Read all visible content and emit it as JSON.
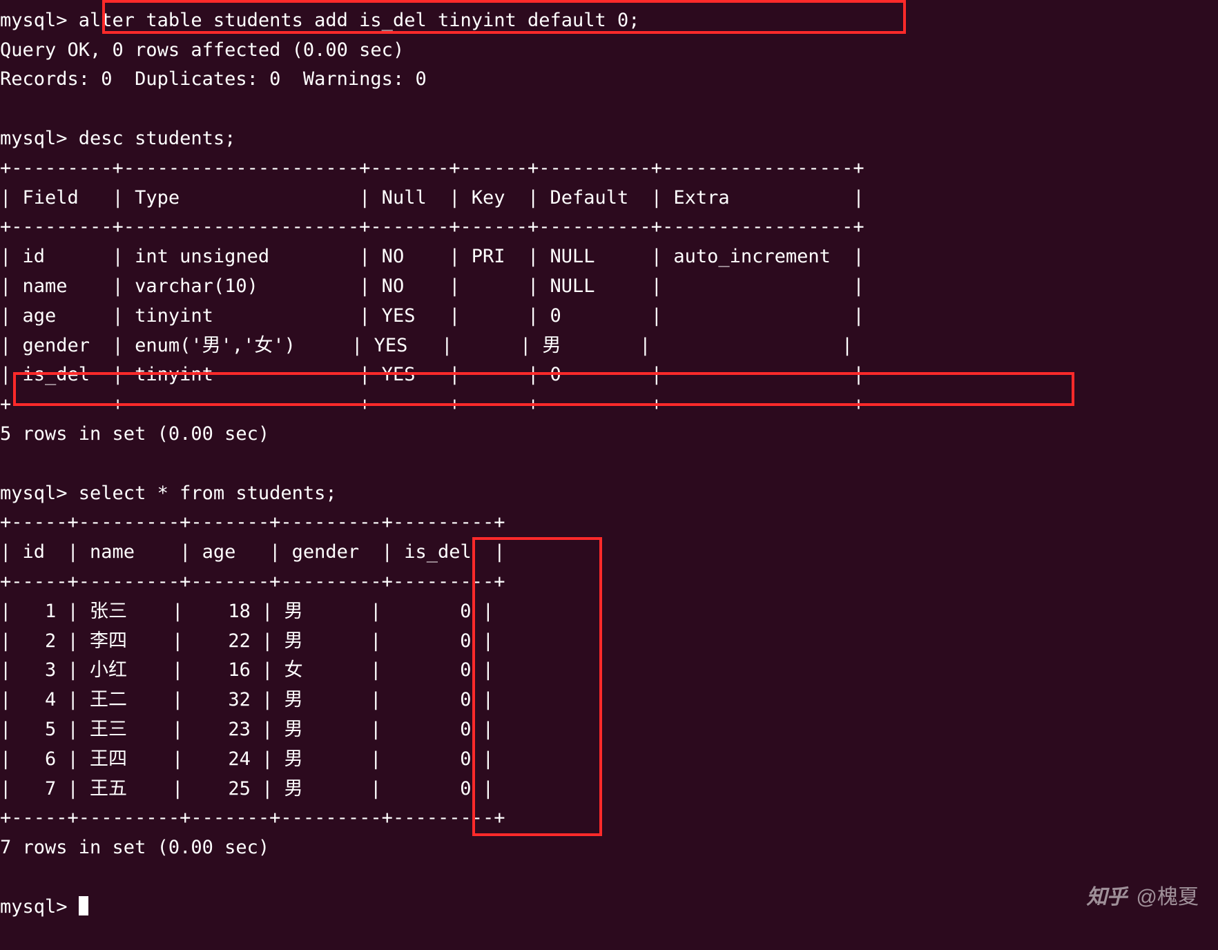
{
  "colors": {
    "bg": "#2c0a1e",
    "fg": "#ffffff",
    "highlight": "#ff2a2a"
  },
  "prompt": "mysql>",
  "alter_cmd": "alter table students add is_del tinyint default 0;",
  "alter_result_line1": "Query OK, 0 rows affected (0.00 sec)",
  "alter_result_line2": "Records: 0  Duplicates: 0  Warnings: 0",
  "desc_cmd": "desc students;",
  "desc_headers": [
    "Field",
    "Type",
    "Null",
    "Key",
    "Default",
    "Extra"
  ],
  "desc_rows": [
    {
      "Field": "id",
      "Type": "int unsigned",
      "Null": "NO",
      "Key": "PRI",
      "Default": "NULL",
      "Extra": "auto_increment"
    },
    {
      "Field": "name",
      "Type": "varchar(10)",
      "Null": "NO",
      "Key": "",
      "Default": "NULL",
      "Extra": ""
    },
    {
      "Field": "age",
      "Type": "tinyint",
      "Null": "YES",
      "Key": "",
      "Default": "0",
      "Extra": ""
    },
    {
      "Field": "gender",
      "Type": "enum('男','女')",
      "Null": "YES",
      "Key": "",
      "Default": "男",
      "Extra": ""
    },
    {
      "Field": "is_del",
      "Type": "tinyint",
      "Null": "YES",
      "Key": "",
      "Default": "0",
      "Extra": ""
    }
  ],
  "desc_footer": "5 rows in set (0.00 sec)",
  "select_cmd": "select * from students;",
  "select_headers": [
    "id",
    "name",
    "age",
    "gender",
    "is_del"
  ],
  "select_rows": [
    {
      "id": "1",
      "name": "张三",
      "age": "18",
      "gender": "男",
      "is_del": "0"
    },
    {
      "id": "2",
      "name": "李四",
      "age": "22",
      "gender": "男",
      "is_del": "0"
    },
    {
      "id": "3",
      "name": "小红",
      "age": "16",
      "gender": "女",
      "is_del": "0"
    },
    {
      "id": "4",
      "name": "王二",
      "age": "32",
      "gender": "男",
      "is_del": "0"
    },
    {
      "id": "5",
      "name": "王三",
      "age": "23",
      "gender": "男",
      "is_del": "0"
    },
    {
      "id": "6",
      "name": "王四",
      "age": "24",
      "gender": "男",
      "is_del": "0"
    },
    {
      "id": "7",
      "name": "王五",
      "age": "25",
      "gender": "男",
      "is_del": "0"
    }
  ],
  "select_footer": "7 rows in set (0.00 sec)",
  "watermark": {
    "logo": "知乎",
    "author": "@槐夏"
  }
}
